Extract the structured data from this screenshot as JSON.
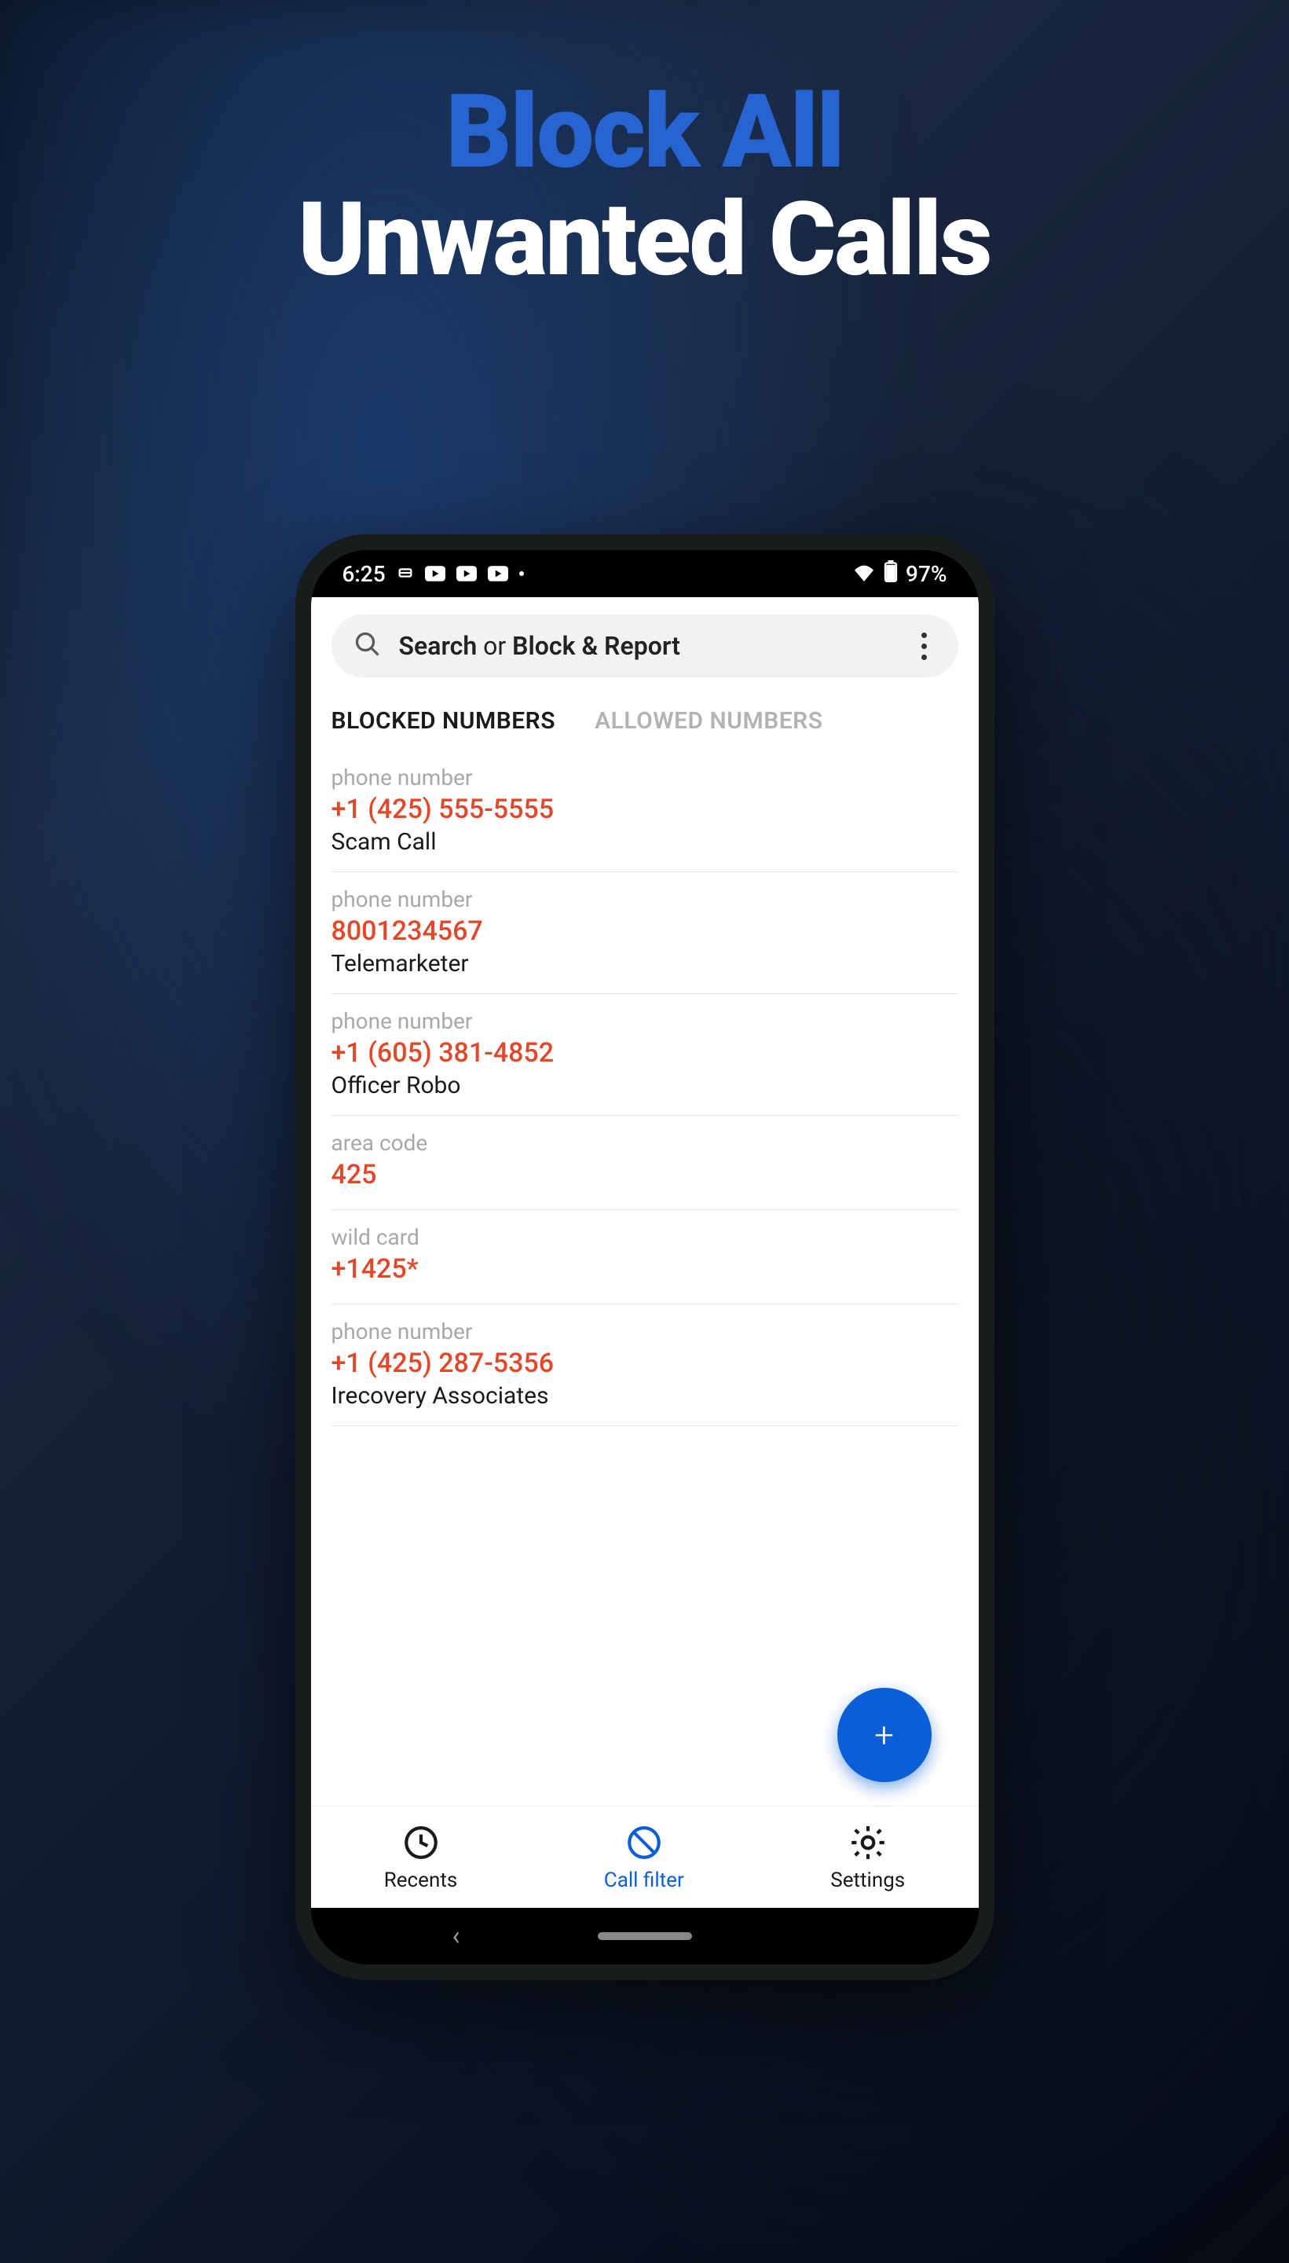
{
  "hero": {
    "line1": "Block All",
    "line2": "Unwanted Calls"
  },
  "status": {
    "time": "6:25",
    "battery": "97%"
  },
  "search": {
    "prefix": "Search",
    "middle": " or ",
    "suffix": "Block & Report"
  },
  "tabs": {
    "blocked": "BLOCKED NUMBERS",
    "allowed": "ALLOWED NUMBERS"
  },
  "entries": [
    {
      "type": "phone number",
      "value": "+1 (425) 555-5555",
      "name": "Scam Call"
    },
    {
      "type": "phone number",
      "value": "8001234567",
      "name": "Telemarketer"
    },
    {
      "type": "phone number",
      "value": "+1 (605) 381-4852",
      "name": "Officer Robo"
    },
    {
      "type": "area code",
      "value": "425",
      "name": ""
    },
    {
      "type": "wild card",
      "value": "+1425*",
      "name": ""
    },
    {
      "type": "phone number",
      "value": "+1 (425) 287-5356",
      "name": "Irecovery Associates"
    }
  ],
  "fab": {
    "icon": "+"
  },
  "nav": {
    "recents": "Recents",
    "callfilter": "Call filter",
    "settings": "Settings"
  }
}
